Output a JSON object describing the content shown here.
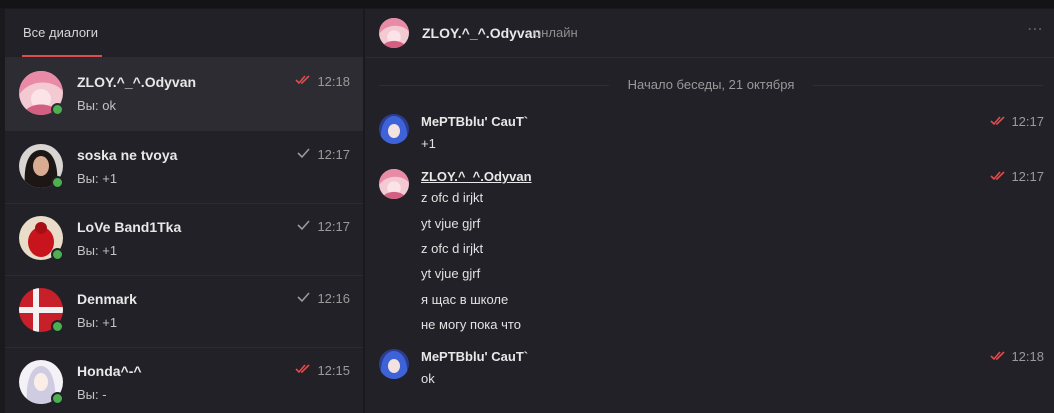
{
  "colors": {
    "accent": "#e24b4b",
    "online": "#4caf50",
    "read_check": "#e24b4b",
    "sent_check": "#9a9a9a"
  },
  "sidebar": {
    "tab_label": "Все диалоги",
    "dialogs": [
      {
        "name": "ZLOY.^_^.Odyvan",
        "preview": "Вы: ok",
        "time": "12:18",
        "check": "double-red",
        "avatar": "pink-anime-avatar"
      },
      {
        "name": "soska ne tvoya",
        "preview": "Вы: +1",
        "time": "12:17",
        "check": "single-grey",
        "avatar": "girl-photo-avatar"
      },
      {
        "name": "LoVe Band1Tka",
        "preview": "Вы: +1",
        "time": "12:17",
        "check": "single-grey",
        "avatar": "red-figure-avatar"
      },
      {
        "name": "Denmark",
        "preview": "Вы: +1",
        "time": "12:16",
        "check": "single-grey",
        "avatar": "denmark-flag-avatar"
      },
      {
        "name": "Honda^-^",
        "preview": "Вы: -",
        "time": "12:15",
        "check": "double-red",
        "avatar": "anime-girl-avatar"
      }
    ]
  },
  "chat": {
    "header": {
      "name": "ZLOY.^_^.Odyvan",
      "status": "онлайн",
      "more": "⋯"
    },
    "date_separator": "Начало беседы, 21 октября",
    "messages": [
      {
        "author": "MePTBblu' CauT`",
        "time": "12:17",
        "lines": [
          "+1"
        ],
        "avatar": "blue-anime-avatar"
      },
      {
        "author": "ZLOY.^_^.Odyvan",
        "time": "12:17",
        "lines": [
          "z ofc d irjkt",
          "yt vjue gjrf",
          "z ofc d irjkt",
          "yt vjue gjrf",
          "я щас в школе",
          "не могу пока что"
        ],
        "avatar": "pink-anime-avatar"
      },
      {
        "author": "MePTBblu' CauT`",
        "time": "12:18",
        "lines": [
          "ok"
        ],
        "avatar": "blue-anime-avatar"
      }
    ]
  }
}
